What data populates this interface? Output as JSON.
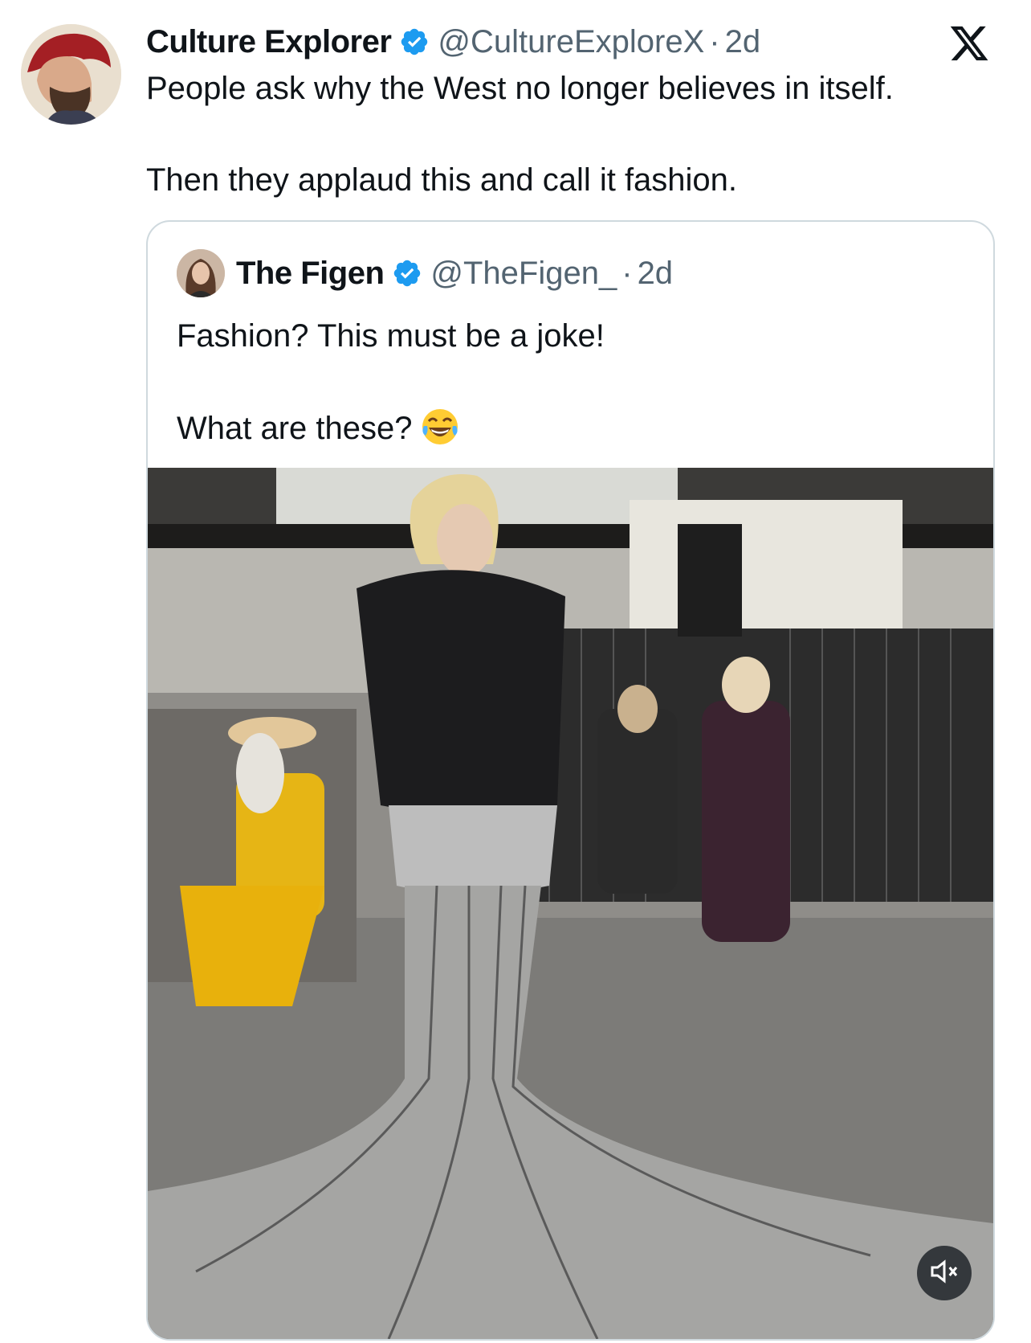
{
  "tweet": {
    "author_name": "Culture Explorer",
    "handle": "@CultureExploreX",
    "separator": "·",
    "time": "2d",
    "lines": [
      "People ask why the West no longer believes in itself.",
      "Then they applaud this and call it fashion."
    ]
  },
  "quoted": {
    "author_name": "The Figen",
    "handle": "@TheFigen_",
    "separator": "·",
    "time": "2d",
    "lines": [
      "Fashion? This must be a joke!",
      "What are these?"
    ],
    "emoji": "face-with-tears-of-joy"
  },
  "icons": {
    "verified": "verified-badge-icon",
    "platform": "x-logo-icon",
    "mute": "volume-muted-icon"
  },
  "colors": {
    "verified": "#1d9bf0",
    "secondary_text": "#536471",
    "border": "#cfd9de"
  }
}
